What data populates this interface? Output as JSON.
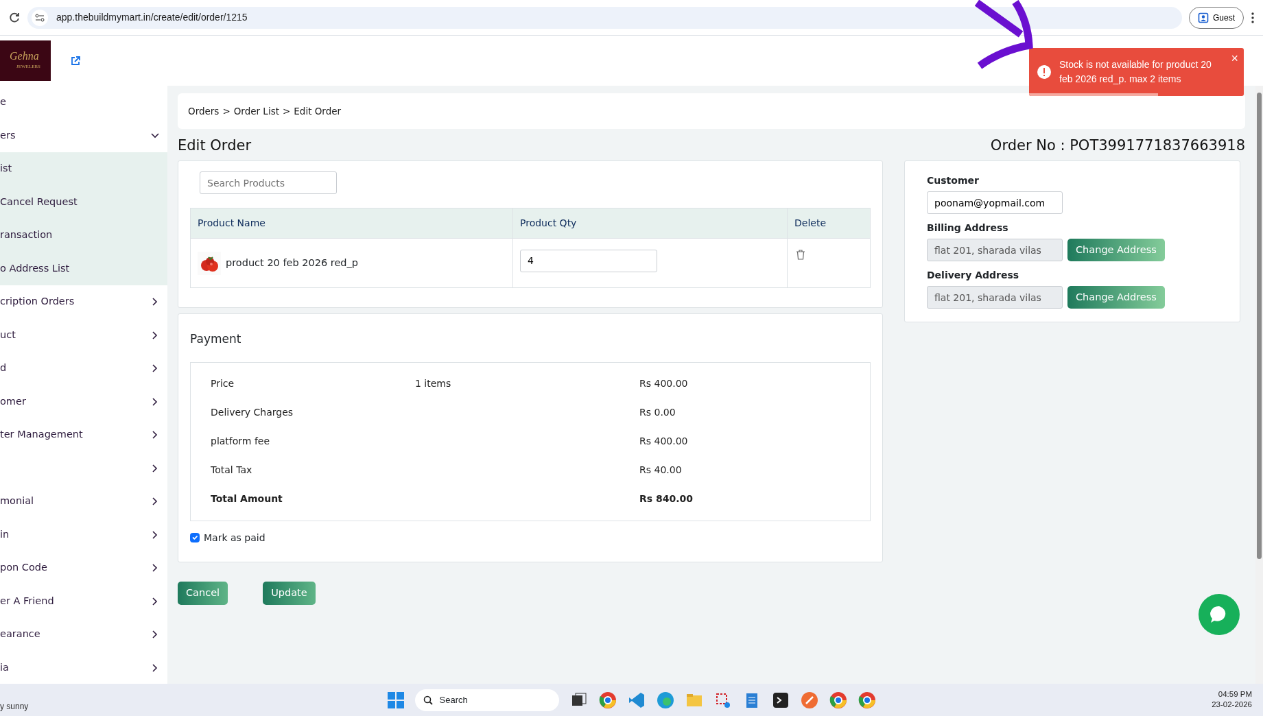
{
  "browser": {
    "url": "app.thebuildmymart.in/create/edit/order/1215",
    "profile": "Guest"
  },
  "header": {
    "logo_text": "Gehna",
    "logo_subtext": "JEWELERS"
  },
  "sidebar": {
    "items": [
      {
        "label": "e",
        "kind": "link"
      },
      {
        "label": "ers",
        "kind": "group",
        "expanded": true,
        "children": [
          {
            "label": "ist"
          },
          {
            "label": "Cancel Request"
          },
          {
            "label": "ransaction"
          },
          {
            "label": "o Address List"
          }
        ]
      },
      {
        "label": "cription Orders",
        "kind": "group",
        "expanded": false
      },
      {
        "label": "uct",
        "kind": "group",
        "expanded": false
      },
      {
        "label": "d",
        "kind": "group",
        "expanded": false
      },
      {
        "label": "omer",
        "kind": "group",
        "expanded": false
      },
      {
        "label": "ter Management",
        "kind": "group",
        "expanded": false
      },
      {
        "kind": "group",
        "expanded": false
      },
      {
        "label": "monial",
        "kind": "group",
        "expanded": false
      },
      {
        "label": "in",
        "kind": "group",
        "expanded": false
      },
      {
        "label": "pon Code",
        "kind": "group",
        "expanded": false
      },
      {
        "label": "er A Friend",
        "kind": "group",
        "expanded": false
      },
      {
        "label": "earance",
        "kind": "group",
        "expanded": false
      },
      {
        "label": "ia",
        "kind": "group",
        "expanded": false
      }
    ]
  },
  "breadcrumb": [
    "Orders",
    "Order List",
    "Edit Order"
  ],
  "breadcrumb_separator": ">",
  "title": "Edit Order",
  "order_no": "Order No : POT3991771837663918",
  "search": {
    "placeholder": "Search Products"
  },
  "table": {
    "columns": [
      "Product Name",
      "Product Qty",
      "Delete"
    ],
    "rows": [
      {
        "product": "product 20 feb 2026 red_p",
        "qty": "4"
      }
    ]
  },
  "payment": {
    "title": "Payment",
    "rows": [
      {
        "label": "Price",
        "count": "1 items",
        "amount": "Rs 400.00",
        "bold": false
      },
      {
        "label": "Delivery Charges",
        "amount": "Rs 0.00",
        "bold": false
      },
      {
        "label": "platform fee",
        "amount": "Rs 400.00",
        "bold": false
      },
      {
        "label": "Total Tax",
        "amount": "Rs 40.00",
        "bold": false
      },
      {
        "label": "Total Amount",
        "amount": "Rs 840.00",
        "bold": true
      }
    ],
    "mark_paid": {
      "label": "Mark as paid",
      "checked": true
    }
  },
  "actions": [
    "Cancel",
    "Update"
  ],
  "customer": {
    "label": "Customer",
    "value": "poonam@yopmail.com"
  },
  "addresses": [
    {
      "label": "Billing Address",
      "value": "flat 201, sharada vilas",
      "button": "Change Address"
    },
    {
      "label": "Delivery Address",
      "value": "flat 201, sharada vilas",
      "button": "Change Address"
    }
  ],
  "toast": {
    "message": "Stock is not available for product 20 feb 2026 red_p. max 2 items",
    "level": 0.6,
    "close": "×"
  },
  "taskbar": {
    "search": "Search",
    "weather": "y sunny",
    "time": "04:59 PM",
    "date": "23-02-2026"
  }
}
